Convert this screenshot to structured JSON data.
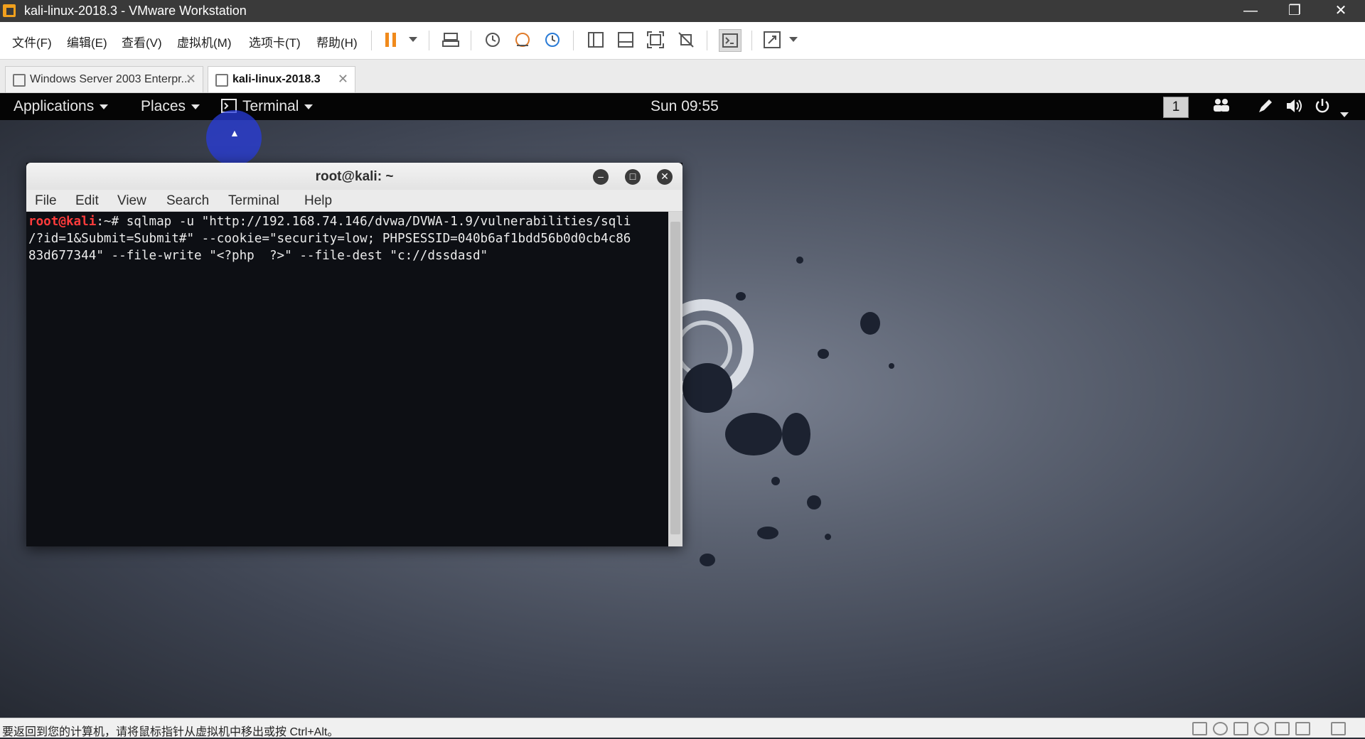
{
  "window": {
    "title": "kali-linux-2018.3 - VMware Workstation",
    "minimize_glyph": "—",
    "restore_glyph": "❐",
    "close_glyph": "✕"
  },
  "menubar": {
    "file": "文件(F)",
    "edit": "编辑(E)",
    "view": "查看(V)",
    "vm": "虚拟机(M)",
    "tabs": "选项卡(T)",
    "help": "帮助(H)"
  },
  "toolbar_icons": [
    "pause-icon",
    "dropdown-icon",
    "send-ctrl-alt-del-icon",
    "snapshot-icon",
    "revert-snapshot-icon",
    "snapshot-manager-icon",
    "show-library-icon",
    "thumbnail-bar-icon",
    "full-screen-icon",
    "unity-icon",
    "console-view-icon",
    "stretch-guest-icon"
  ],
  "tabs": [
    {
      "label": "Windows Server 2003 Enterpr...",
      "active": false
    },
    {
      "label": "kali-linux-2018.3",
      "active": true
    }
  ],
  "guest": {
    "topbar": {
      "applications": "Applications",
      "places": "Places",
      "terminal": "Terminal",
      "clock": "Sun 09:55",
      "workspace": "1"
    },
    "terminal": {
      "title": "root@kali: ~",
      "menu": [
        "File",
        "Edit",
        "View",
        "Search",
        "Terminal",
        "Help"
      ],
      "prompt_user": "root@kali",
      "prompt_rest": ":~# ",
      "command_line1": "sqlmap -u \"http://192.168.74.146/dvwa/DVWA-1.9/vulnerabilities/sqli",
      "command_line2": "/?id=1&Submit=Submit#\" --cookie=\"security=low; PHPSESSID=040b6af1bdd56b0d0cb4c86",
      "command_line3": "83d677344\" --file-write \"<?php  ?>\" --file-dest \"c://dssdasd\""
    }
  },
  "statusbar": {
    "text": "要返回到您的计算机，请将鼠标指针从虚拟机中移出或按 Ctrl+Alt。"
  },
  "colors": {
    "prompt": "#ff3b3b",
    "pause_accent": "#f08a1c",
    "app_icon": "#f1a01d"
  }
}
